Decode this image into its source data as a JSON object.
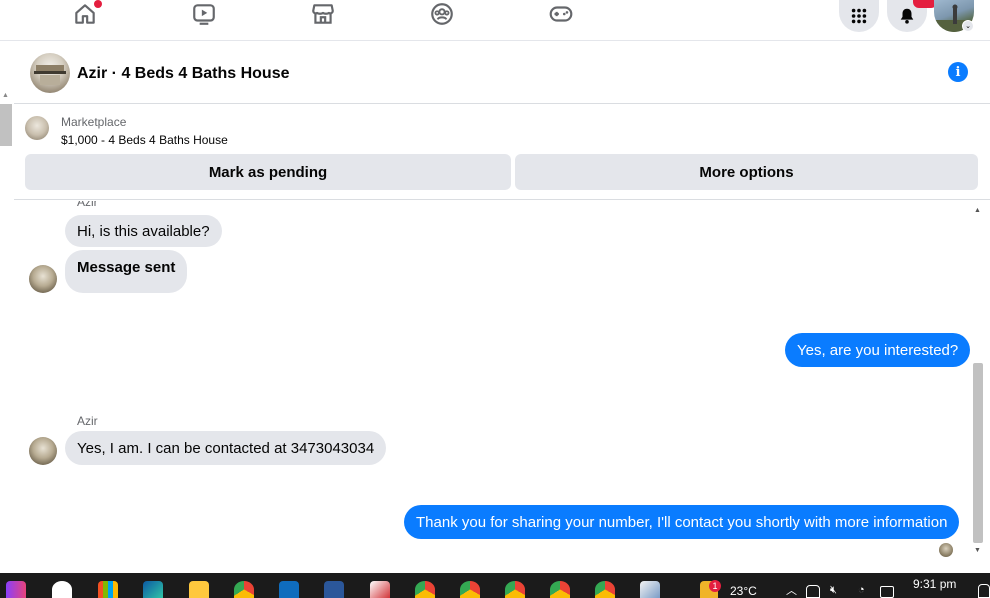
{
  "conversation": {
    "title": "Azir · 4 Beds 4 Baths House"
  },
  "marketplace": {
    "label": "Marketplace",
    "listing": "$1,000 - 4 Beds 4 Baths House",
    "pending_button": "Mark as pending",
    "options_button": "More options"
  },
  "messages": [
    {
      "sender": "Azir",
      "text": "Hi, is this available?",
      "direction": "in"
    },
    {
      "sender": "",
      "text": "Message sent",
      "direction": "in"
    },
    {
      "sender": "",
      "text": "Yes, are you interested?",
      "direction": "out"
    },
    {
      "sender": "Azir",
      "text": "Yes, I am. I can be contacted at 3473043034",
      "direction": "in"
    },
    {
      "sender": "",
      "text": "Thank you for sharing your number, I'll contact you shortly with more information",
      "direction": "out"
    }
  ],
  "taskbar": {
    "temperature": "23°C",
    "weather_badge": "1",
    "time": "9:31 pm"
  },
  "colors": {
    "accent": "#0a7cff",
    "bubble_in": "#e4e6eb",
    "notification": "#e41e3f"
  }
}
